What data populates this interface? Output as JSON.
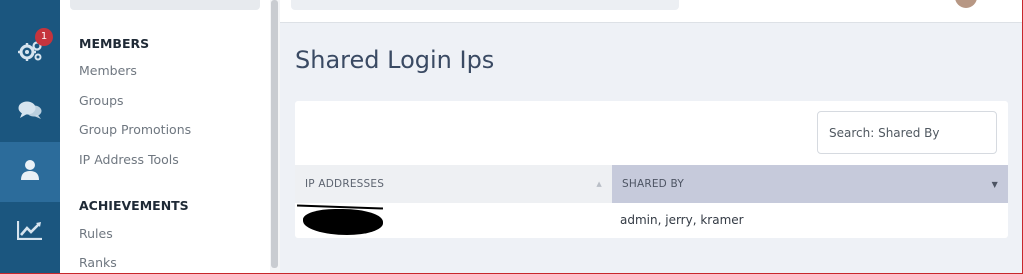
{
  "rail": {
    "badge_count": "1",
    "items": [
      {
        "icon": "gears-icon"
      },
      {
        "icon": "chat-icon"
      },
      {
        "icon": "user-icon",
        "active": true
      },
      {
        "icon": "chart-line-icon"
      }
    ]
  },
  "submenu": {
    "sections": [
      {
        "heading": "MEMBERS",
        "links": [
          "Members",
          "Groups",
          "Group Promotions",
          "IP Address Tools"
        ]
      },
      {
        "heading": "ACHIEVEMENTS",
        "links": [
          "Rules",
          "Ranks"
        ]
      }
    ]
  },
  "page": {
    "title": "Shared Login Ips"
  },
  "table": {
    "search_placeholder": "Search: Shared By",
    "columns": [
      "IP ADDRESSES",
      "SHARED BY"
    ],
    "rows": [
      {
        "ip": "",
        "shared_by": "admin, jerry, kramer"
      }
    ]
  },
  "colors": {
    "rail_bg": "#1b567f",
    "rail_active": "#2c6c9b",
    "badge": "#c5343d",
    "title": "#3a4a63",
    "sorted_header_bg": "#c6cadb"
  }
}
